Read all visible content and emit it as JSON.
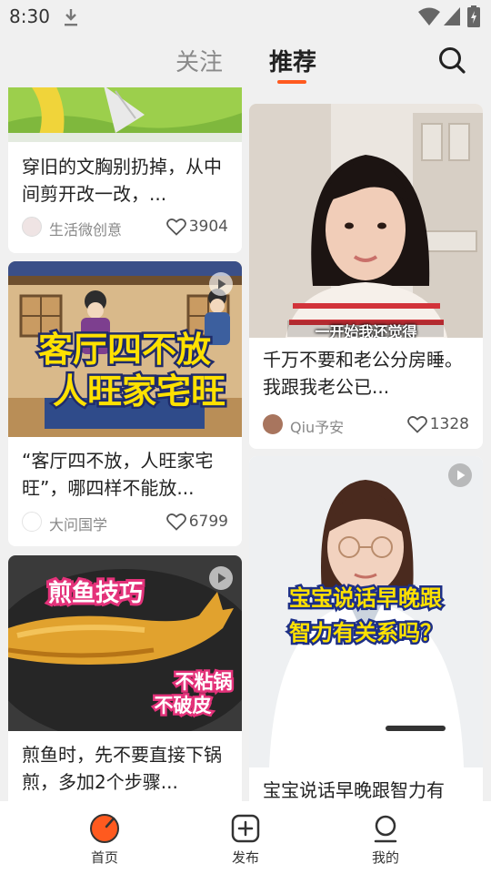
{
  "status_bar": {
    "time": "8:30"
  },
  "top_tabs": {
    "follow": "关注",
    "recommend": "推荐"
  },
  "feed": {
    "left": [
      {
        "title": "穿旧的文胸别扔掉，从中间剪开改一改，...",
        "author": "生活微创意",
        "likes": "3904"
      },
      {
        "title": "“客厅四不放，人旺家宅旺”，哪四样不能放...",
        "author": "大问国学",
        "likes": "6799",
        "thumb_text": [
          "客厅四不放",
          "人旺家宅旺"
        ]
      },
      {
        "title": "煎鱼时，先不要直接下锅煎，多加2个步骤...",
        "thumb_text": [
          "煎鱼技巧",
          "不粘锅",
          "不破皮"
        ]
      }
    ],
    "right": [
      {
        "title": "千万不要和老公分房睡。 我跟我老公已...",
        "author": "Qiu予安",
        "likes": "1328",
        "thumb_caption": "一开始我还觉得"
      },
      {
        "title": "宝宝说话早晚跟智力有",
        "thumb_text": [
          "宝宝说话早晚跟",
          "智力有关系吗？"
        ]
      }
    ]
  },
  "bottom_nav": {
    "home": "首页",
    "publish": "发布",
    "mine": "我的"
  },
  "colors": {
    "accent": "#ff5a1f",
    "background": "#f0f0f0"
  }
}
